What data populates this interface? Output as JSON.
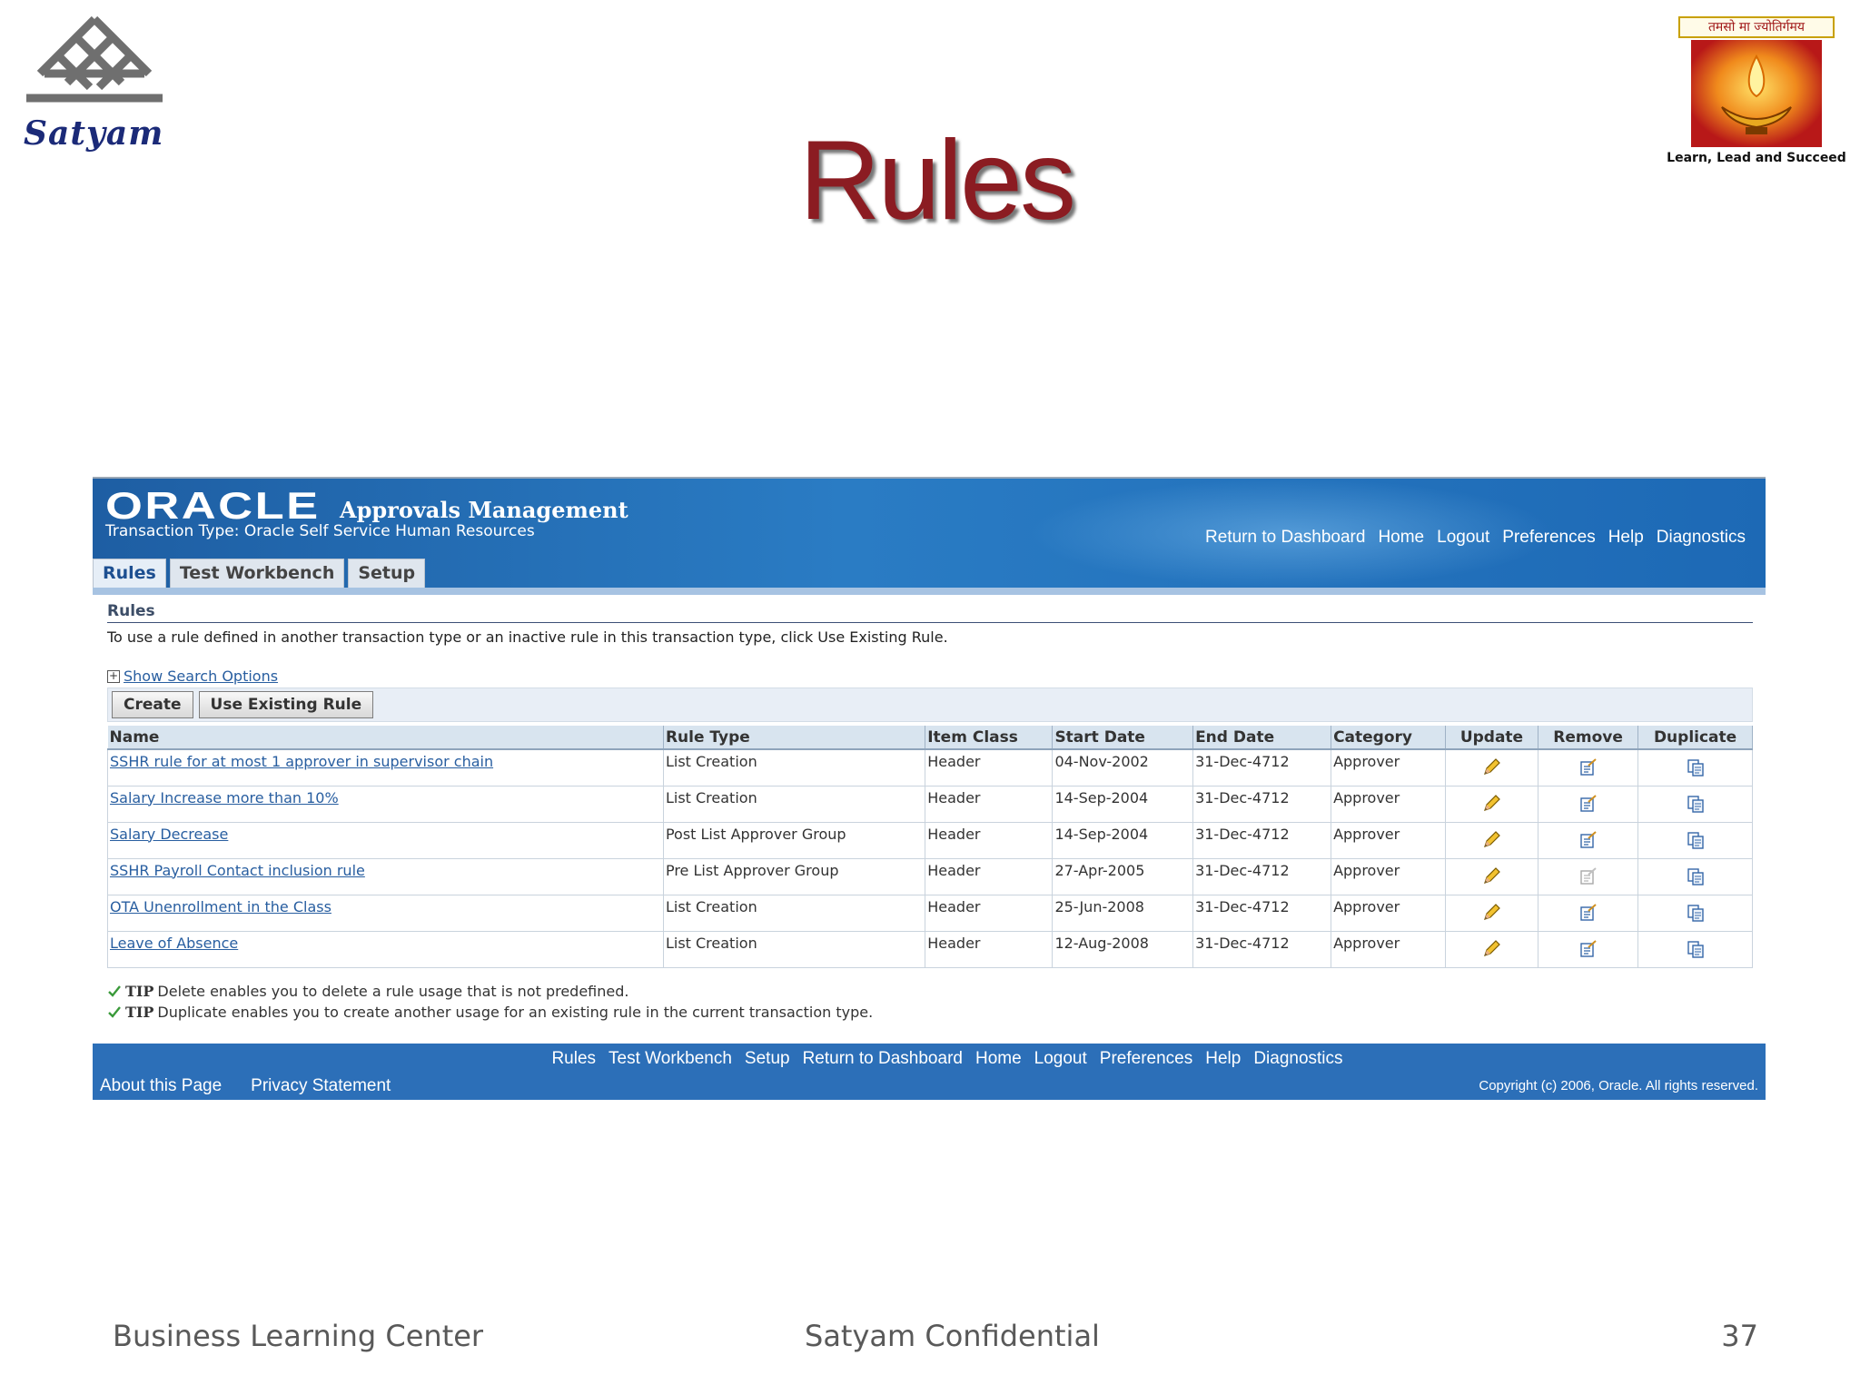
{
  "slide": {
    "title": "Rules",
    "logo_left_text": "Satyam",
    "logo_right_banner": "तमसो मा ज्योतिर्गमय",
    "logo_right_tagline": "Learn, Lead and Succeed",
    "footer_left": "Business Learning Center",
    "footer_center": "Satyam Confidential",
    "footer_page": "37"
  },
  "app": {
    "brand": "ORACLE",
    "name": "Approvals Management",
    "transaction_type": "Transaction Type: Oracle Self Service Human Resources",
    "global_links": [
      "Return to Dashboard",
      "Home",
      "Logout",
      "Preferences",
      "Help",
      "Diagnostics"
    ],
    "tabs": [
      "Rules",
      "Test Workbench",
      "Setup"
    ],
    "active_tab": "Rules"
  },
  "page": {
    "heading": "Rules",
    "instruction": "To use a rule defined in another transaction type or an inactive rule in this transaction type, click Use Existing Rule.",
    "search_toggle": "Show Search Options",
    "buttons": {
      "create": "Create",
      "use_existing": "Use Existing Rule"
    }
  },
  "table": {
    "columns": [
      "Name",
      "Rule Type",
      "Item Class",
      "Start Date",
      "End Date",
      "Category",
      "Update",
      "Remove",
      "Duplicate"
    ],
    "rows": [
      {
        "name": "SSHR rule for at most 1 approver in supervisor chain",
        "rule_type": "List Creation",
        "item_class": "Header",
        "start": "04-Nov-2002",
        "end": "31-Dec-4712",
        "category": "Approver",
        "remove_enabled": true
      },
      {
        "name": "Salary Increase more than 10%",
        "rule_type": "List Creation",
        "item_class": "Header",
        "start": "14-Sep-2004",
        "end": "31-Dec-4712",
        "category": "Approver",
        "remove_enabled": true
      },
      {
        "name": "Salary Decrease",
        "rule_type": "Post List Approver Group",
        "item_class": "Header",
        "start": "14-Sep-2004",
        "end": "31-Dec-4712",
        "category": "Approver",
        "remove_enabled": true
      },
      {
        "name": "SSHR Payroll Contact inclusion rule",
        "rule_type": "Pre List Approver Group",
        "item_class": "Header",
        "start": "27-Apr-2005",
        "end": "31-Dec-4712",
        "category": "Approver",
        "remove_enabled": false
      },
      {
        "name": "OTA Unenrollment in the Class",
        "rule_type": "List Creation",
        "item_class": "Header",
        "start": "25-Jun-2008",
        "end": "31-Dec-4712",
        "category": "Approver",
        "remove_enabled": true
      },
      {
        "name": "Leave of Absence",
        "rule_type": "List Creation",
        "item_class": "Header",
        "start": "12-Aug-2008",
        "end": "31-Dec-4712",
        "category": "Approver",
        "remove_enabled": true
      }
    ]
  },
  "tips": [
    {
      "label": "TIP",
      "text": "Delete enables you to delete a rule usage that is not predefined."
    },
    {
      "label": "TIP",
      "text": "Duplicate enables you to create another usage for an existing rule in the current transaction type."
    }
  ],
  "footer": {
    "links": [
      "Rules",
      "Test Workbench",
      "Setup",
      "Return to Dashboard",
      "Home",
      "Logout",
      "Preferences",
      "Help",
      "Diagnostics"
    ],
    "about": "About this Page",
    "privacy": "Privacy Statement",
    "copyright": "Copyright (c) 2006, Oracle. All rights reserved."
  },
  "icons": {
    "update": "pencil-icon",
    "remove": "delete-checklist-icon",
    "duplicate": "copy-documents-icon",
    "tip": "checkmark-icon",
    "expand": "plus-box-icon"
  },
  "colors": {
    "slide_title": "#8b1c22",
    "oracle_header": "#2a7cc4",
    "link": "#285ea0",
    "table_header": "#d8e4ef"
  }
}
